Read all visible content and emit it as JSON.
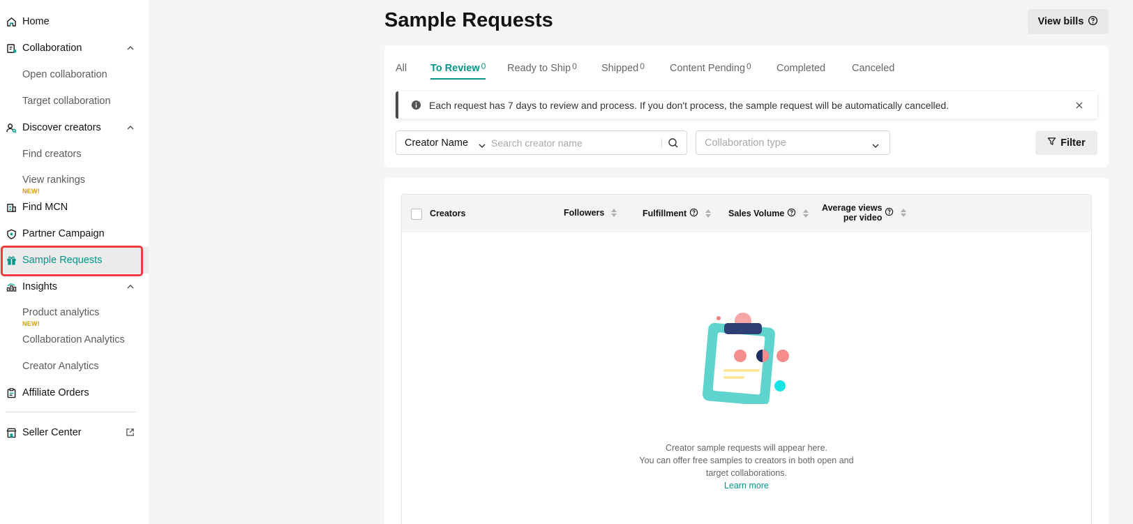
{
  "sidebar": {
    "home": "Home",
    "collaboration": "Collaboration",
    "open_collaboration": "Open collaboration",
    "target_collaboration": "Target collaboration",
    "discover_creators": "Discover creators",
    "find_creators": "Find creators",
    "view_rankings": "View rankings",
    "new_badge": "NEW!",
    "find_mcn": "Find MCN",
    "partner_campaign": "Partner Campaign",
    "sample_requests": "Sample Requests",
    "insights": "Insights",
    "product_analytics": "Product analytics",
    "collaboration_analytics": "Collaboration Analytics",
    "creator_analytics": "Creator Analytics",
    "affiliate_orders": "Affiliate Orders",
    "seller_center": "Seller Center"
  },
  "header": {
    "title": "Sample Requests",
    "view_bills": "View bills"
  },
  "tabs": [
    {
      "label": "All",
      "count": ""
    },
    {
      "label": "To Review",
      "count": "0"
    },
    {
      "label": "Ready to Ship",
      "count": "0"
    },
    {
      "label": "Shipped",
      "count": "0"
    },
    {
      "label": "Content Pending",
      "count": "0"
    },
    {
      "label": "Completed",
      "count": ""
    },
    {
      "label": "Canceled",
      "count": ""
    }
  ],
  "notice": {
    "text": "Each request has 7 days to review and process. If you don't process, the sample request will be automatically cancelled."
  },
  "search": {
    "field_select": "Creator Name",
    "placeholder": "Search creator name"
  },
  "collab_type": {
    "placeholder": "Collaboration type"
  },
  "filter": {
    "label": "Filter"
  },
  "table": {
    "headers": {
      "creators": "Creators",
      "followers": "Followers",
      "fulfillment": "Fulfillment",
      "sales_volume": "Sales Volume",
      "avg_views_line1": "Average views",
      "avg_views_line2": "per video"
    }
  },
  "empty_state": {
    "line1": "Creator sample requests will appear here.",
    "line2": "You can offer free samples to creators in both open and target collaborations.",
    "learn_more": "Learn more"
  },
  "colors": {
    "accent": "#00968a",
    "highlight": "#ee3b3b",
    "new_badge": "#e09b00"
  }
}
